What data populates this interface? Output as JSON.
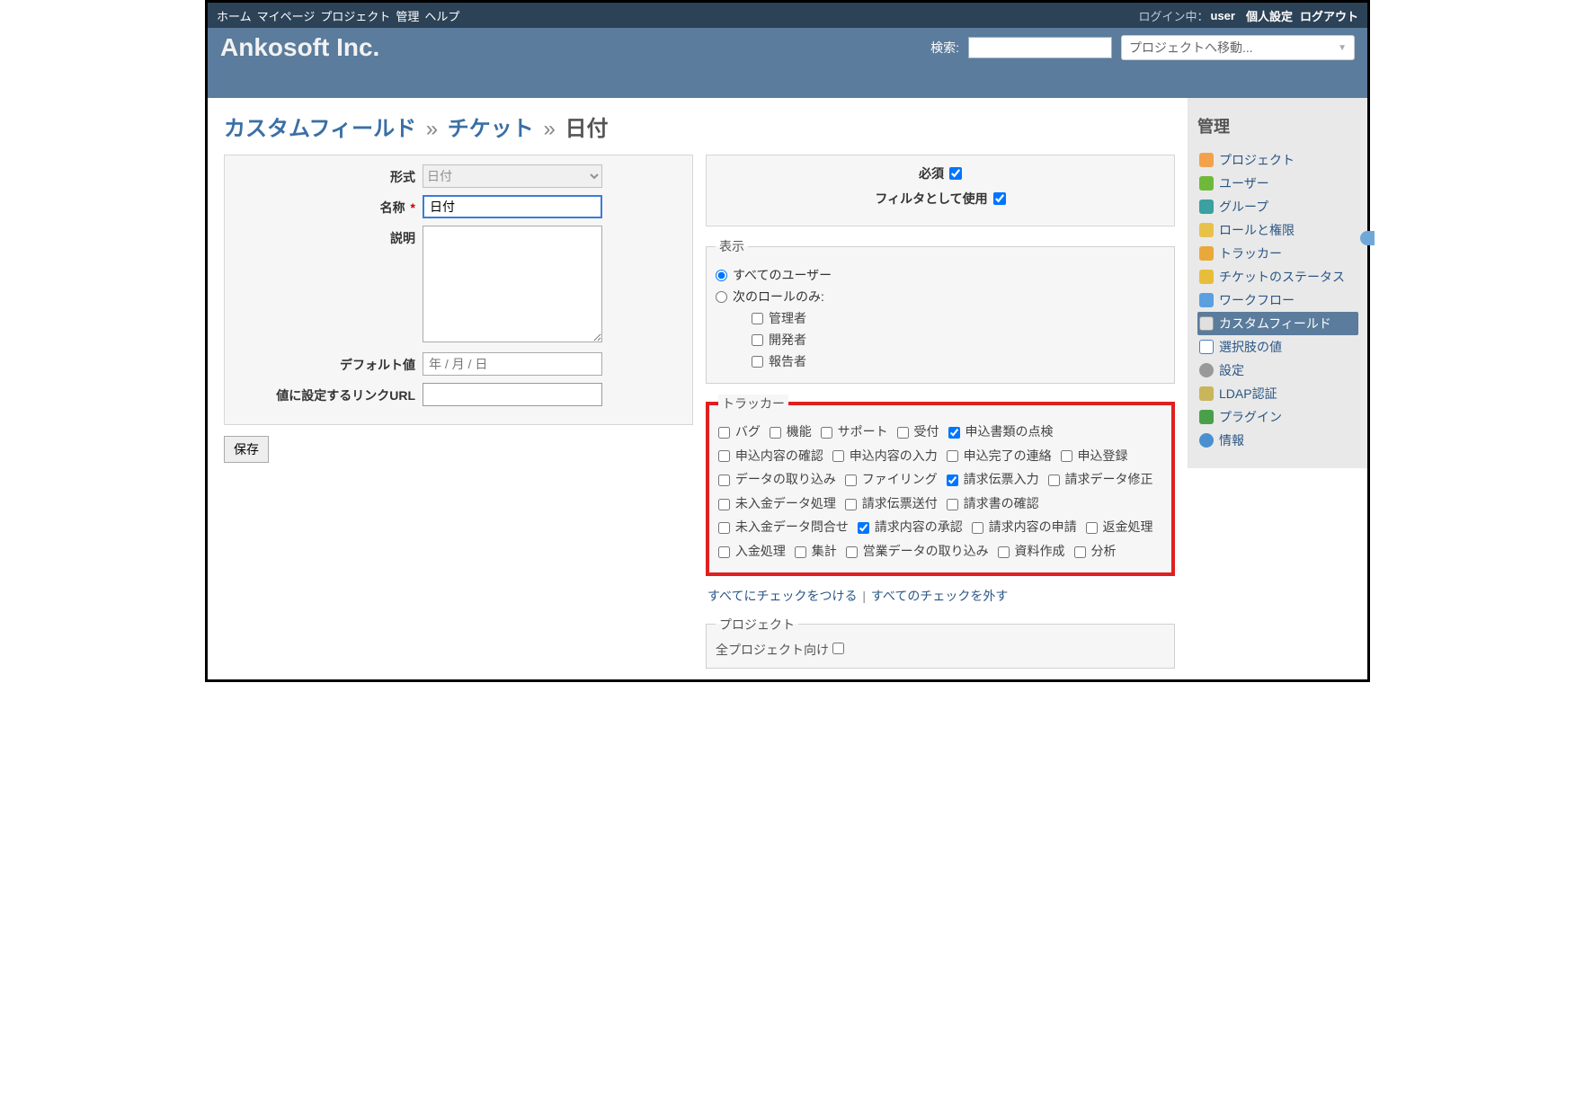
{
  "top": {
    "nav": [
      "ホーム",
      "マイページ",
      "プロジェクト",
      "管理",
      "ヘルプ"
    ],
    "login_label": "ログイン中：",
    "user": "user",
    "prefs": "個人設定",
    "logout": "ログアウト"
  },
  "header": {
    "title": "Ankosoft Inc.",
    "search_label": "検索:",
    "project_select": "プロジェクトへ移動..."
  },
  "breadcrumb": {
    "a": "カスタムフィールド",
    "b": "チケット",
    "c": "日付"
  },
  "left": {
    "format_label": "形式",
    "format_value": "日付",
    "name_label": "名称",
    "name_value": "日付",
    "desc_label": "説明",
    "default_label": "デフォルト値",
    "default_placeholder": "年 / 月 / 日",
    "url_label": "値に設定するリンクURL",
    "save": "保存"
  },
  "right": {
    "required_label": "必須",
    "required_checked": true,
    "filter_label": "フィルタとして使用",
    "filter_checked": true,
    "visibility": {
      "legend": "表示",
      "all": "すべてのユーザー",
      "roles_only": "次のロールのみ:",
      "roles": [
        "管理者",
        "開発者",
        "報告者"
      ]
    },
    "trackers": {
      "legend": "トラッカー",
      "items": [
        {
          "label": "バグ",
          "checked": false
        },
        {
          "label": "機能",
          "checked": false
        },
        {
          "label": "サポート",
          "checked": false
        },
        {
          "label": "受付",
          "checked": false
        },
        {
          "label": "申込書類の点検",
          "checked": true
        },
        {
          "label": "申込内容の確認",
          "checked": false
        },
        {
          "label": "申込内容の入力",
          "checked": false
        },
        {
          "label": "申込完了の連絡",
          "checked": false
        },
        {
          "label": "申込登録",
          "checked": false
        },
        {
          "label": "データの取り込み",
          "checked": false
        },
        {
          "label": "ファイリング",
          "checked": false
        },
        {
          "label": "請求伝票入力",
          "checked": true
        },
        {
          "label": "請求データ修正",
          "checked": false
        },
        {
          "label": "未入金データ処理",
          "checked": false
        },
        {
          "label": "請求伝票送付",
          "checked": false
        },
        {
          "label": "請求書の確認",
          "checked": false
        },
        {
          "label": "未入金データ問合せ",
          "checked": false
        },
        {
          "label": "請求内容の承認",
          "checked": true
        },
        {
          "label": "請求内容の申請",
          "checked": false
        },
        {
          "label": "返金処理",
          "checked": false
        },
        {
          "label": "入金処理",
          "checked": false
        },
        {
          "label": "集計",
          "checked": false
        },
        {
          "label": "営業データの取り込み",
          "checked": false
        },
        {
          "label": "資料作成",
          "checked": false
        },
        {
          "label": "分析",
          "checked": false
        }
      ],
      "check_all": "すべてにチェックをつける",
      "uncheck_all": "すべてのチェックを外す"
    },
    "projects": {
      "legend": "プロジェクト",
      "all_label": "全プロジェクト向け"
    }
  },
  "sidebar": {
    "title": "管理",
    "items": [
      {
        "label": "プロジェクト",
        "icon": "ic-orange"
      },
      {
        "label": "ユーザー",
        "icon": "ic-green"
      },
      {
        "label": "グループ",
        "icon": "ic-teal"
      },
      {
        "label": "ロールと権限",
        "icon": "ic-yellow"
      },
      {
        "label": "トラッカー",
        "icon": "ic-ybox"
      },
      {
        "label": "チケットのステータス",
        "icon": "ic-star"
      },
      {
        "label": "ワークフロー",
        "icon": "ic-arrows"
      },
      {
        "label": "カスタムフィールド",
        "icon": "ic-form",
        "selected": true
      },
      {
        "label": "選択肢の値",
        "icon": "ic-list"
      },
      {
        "label": "設定",
        "icon": "ic-gear"
      },
      {
        "label": "LDAP認証",
        "icon": "ic-key"
      },
      {
        "label": "プラグイン",
        "icon": "ic-puzzle"
      },
      {
        "label": "情報",
        "icon": "ic-info"
      }
    ]
  }
}
